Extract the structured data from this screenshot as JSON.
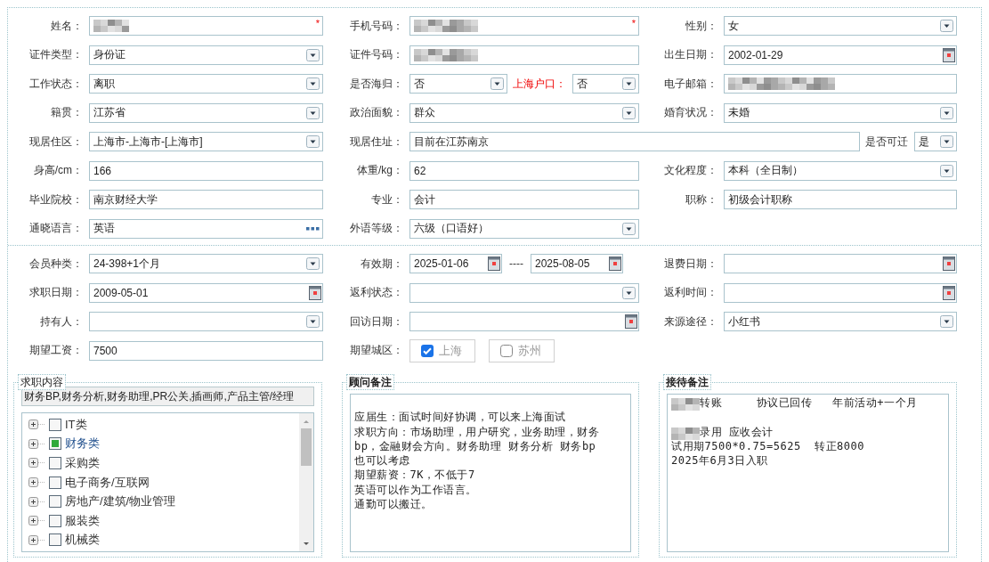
{
  "sections": [
    {
      "rows": [
        {
          "cells": [
            {
              "fields": [
                {
                  "label": "姓名：",
                  "kind": "redacted",
                  "required_mark": "*"
                }
              ]
            },
            {
              "fields": [
                {
                  "label": "手机号码：",
                  "kind": "redacted",
                  "required_mark": "*"
                }
              ]
            },
            {
              "fields": [
                {
                  "label": "性别：",
                  "kind": "select",
                  "value": "女"
                }
              ]
            }
          ]
        },
        {
          "cells": [
            {
              "fields": [
                {
                  "label": "证件类型：",
                  "kind": "select",
                  "value": "身份证"
                }
              ]
            },
            {
              "fields": [
                {
                  "label": "证件号码：",
                  "kind": "redacted"
                }
              ]
            },
            {
              "fields": [
                {
                  "label": "出生日期：",
                  "kind": "date",
                  "value": "2002-01-29"
                }
              ]
            }
          ]
        },
        {
          "cells": [
            {
              "fields": [
                {
                  "label": "工作状态：",
                  "kind": "select",
                  "value": "离职"
                }
              ]
            },
            {
              "fields": [
                {
                  "label": "是否海归：",
                  "kind": "select",
                  "value": "否",
                  "highlight": false
                },
                {
                  "label": "上海户口：",
                  "kind": "select",
                  "value": "否",
                  "highlight": true
                }
              ]
            },
            {
              "fields": [
                {
                  "label": "电子邮箱：",
                  "kind": "redacted"
                }
              ]
            }
          ]
        },
        {
          "cells": [
            {
              "fields": [
                {
                  "label": "籍贯：",
                  "kind": "select",
                  "value": "江苏省"
                }
              ]
            },
            {
              "fields": [
                {
                  "label": "政治面貌：",
                  "kind": "select",
                  "value": "群众"
                }
              ]
            },
            {
              "fields": [
                {
                  "label": "婚育状况：",
                  "kind": "select",
                  "value": "未婚"
                }
              ]
            }
          ]
        },
        {
          "cells": [
            {
              "fields": [
                {
                  "label": "现居住区：",
                  "kind": "select",
                  "value": "上海市-上海市-[上海市]"
                }
              ]
            },
            {
              "wide": true,
              "fields": [
                {
                  "label": "现居住址：",
                  "kind": "text",
                  "value": "目前在江苏南京"
                },
                {
                  "label": "是否可迁",
                  "kind": "select",
                  "value": "是"
                }
              ]
            }
          ]
        },
        {
          "cells": [
            {
              "fields": [
                {
                  "label": "身高/cm：",
                  "kind": "text",
                  "value": "166"
                }
              ]
            },
            {
              "fields": [
                {
                  "label": "体重/kg：",
                  "kind": "text",
                  "value": "62"
                }
              ]
            },
            {
              "fields": [
                {
                  "label": "文化程度：",
                  "kind": "select",
                  "value": "本科（全日制）"
                }
              ]
            }
          ]
        },
        {
          "cells": [
            {
              "fields": [
                {
                  "label": "毕业院校：",
                  "kind": "text",
                  "value": "南京财经大学"
                }
              ]
            },
            {
              "fields": [
                {
                  "label": "专业：",
                  "kind": "text",
                  "value": "会计"
                }
              ]
            },
            {
              "fields": [
                {
                  "label": "职称：",
                  "kind": "text",
                  "value": "初级会计职称"
                }
              ]
            }
          ]
        },
        {
          "cells": [
            {
              "fields": [
                {
                  "label": "通晓语言：",
                  "kind": "lookup",
                  "value": "英语"
                }
              ]
            },
            {
              "fields": [
                {
                  "label": "外语等级：",
                  "kind": "select",
                  "value": "六级（口语好）"
                }
              ]
            }
          ]
        }
      ]
    },
    {
      "rows": [
        {
          "cells": [
            {
              "fields": [
                {
                  "label": "会员种类：",
                  "kind": "select",
                  "value": "24-398+1个月"
                }
              ]
            },
            {
              "fields": [
                {
                  "label": "有效期：",
                  "kind": "date_range",
                  "value": "2025-01-06",
                  "separator": "----",
                  "end_value": "2025-08-05"
                }
              ]
            },
            {
              "fields": [
                {
                  "label": "退费日期：",
                  "kind": "date"
                }
              ]
            }
          ]
        },
        {
          "cells": [
            {
              "fields": [
                {
                  "label": "求职日期：",
                  "kind": "date",
                  "value": "2009-05-01"
                }
              ]
            },
            {
              "fields": [
                {
                  "label": "返利状态：",
                  "kind": "select"
                }
              ]
            },
            {
              "fields": [
                {
                  "label": "返利时间：",
                  "kind": "date"
                }
              ]
            }
          ]
        },
        {
          "cells": [
            {
              "fields": [
                {
                  "label": "持有人：",
                  "kind": "select"
                }
              ]
            },
            {
              "fields": [
                {
                  "label": "回访日期：",
                  "kind": "date"
                }
              ]
            },
            {
              "fields": [
                {
                  "label": "来源途径：",
                  "kind": "select",
                  "value": "小红书"
                }
              ]
            }
          ]
        },
        {
          "cells": [
            {
              "fields": [
                {
                  "label": "期望工资：",
                  "kind": "text",
                  "value": "7500"
                }
              ]
            },
            {
              "fields": [
                {
                  "label": "期望城区：",
                  "kind": "checks",
                  "options": [
                    {
                      "label": "上海",
                      "checked": true
                    },
                    {
                      "label": "苏州",
                      "checked": false
                    }
                  ]
                }
              ]
            }
          ]
        }
      ]
    }
  ],
  "groups": [
    {
      "kind": "tree",
      "title": "求职内容",
      "summary": "财务BP,财务分析,财务助理,PR公关,插画师,产品主管/经理",
      "items": [
        {
          "label": "IT类",
          "checked": false
        },
        {
          "label": "财务类",
          "checked": true
        },
        {
          "label": "采购类",
          "checked": false
        },
        {
          "label": "电子商务/互联网",
          "checked": false
        },
        {
          "label": "房地产/建筑/物业管理",
          "checked": false
        },
        {
          "label": "服装类",
          "checked": false
        },
        {
          "label": "机械类",
          "checked": false
        }
      ]
    },
    {
      "kind": "notes",
      "title": "顾问备注",
      "lines": [
        {
          "text": "应届生：面试时间好协调，可以来上海面试",
          "gap_before": true
        },
        {
          "text": "求职方向：市场助理，用户研究，业务助理，财务"
        },
        {
          "text": "bp，金融财会方向。财务助理 财务分析 财务bp"
        },
        {
          "text": "也可以考虑"
        },
        {
          "text": "期望薪资：7K，不低于7"
        },
        {
          "text": "英语可以作为工作语言。"
        },
        {
          "text": "通勤可以搬迁。"
        }
      ]
    },
    {
      "kind": "notes",
      "title": "接待备注",
      "lines": [
        {
          "text": "转账     协议已回传   年前活动+一个月",
          "redacted": true
        },
        {
          "text": "录用 应收会计",
          "redacted": true,
          "gap_before": true
        },
        {
          "text": "试用期7500*0.75=5625  转正8000"
        },
        {
          "text": "2025年6月3日入职"
        }
      ]
    }
  ]
}
